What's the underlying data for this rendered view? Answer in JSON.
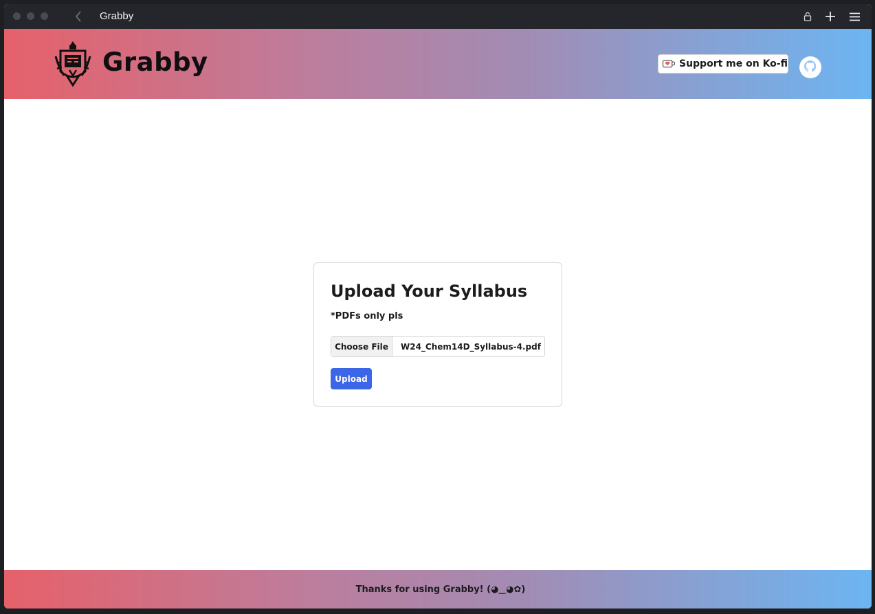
{
  "window": {
    "title": "Grabby"
  },
  "chrome": {
    "back_icon": "chevron-left-icon",
    "lock_icon": "lock-icon",
    "new_tab_icon": "plus-icon",
    "menu_icon": "hamburger-menu-icon"
  },
  "header": {
    "brand": "Grabby",
    "kofi_label": "Support me on Ko-fi",
    "github_icon": "github-icon",
    "gradient": [
      "#e6616a",
      "#a28cb4",
      "#6cb5f2"
    ]
  },
  "card": {
    "title": "Upload Your Syllabus",
    "subtitle": "*PDFs only pls",
    "choose_file_label": "Choose File",
    "file_name": "W24_Chem14D_Syllabus-4.pdf",
    "upload_label": "Upload",
    "accent": "#3b66e8"
  },
  "footer": {
    "text": "Thanks for using Grabby! (◕‿◕✿)"
  }
}
